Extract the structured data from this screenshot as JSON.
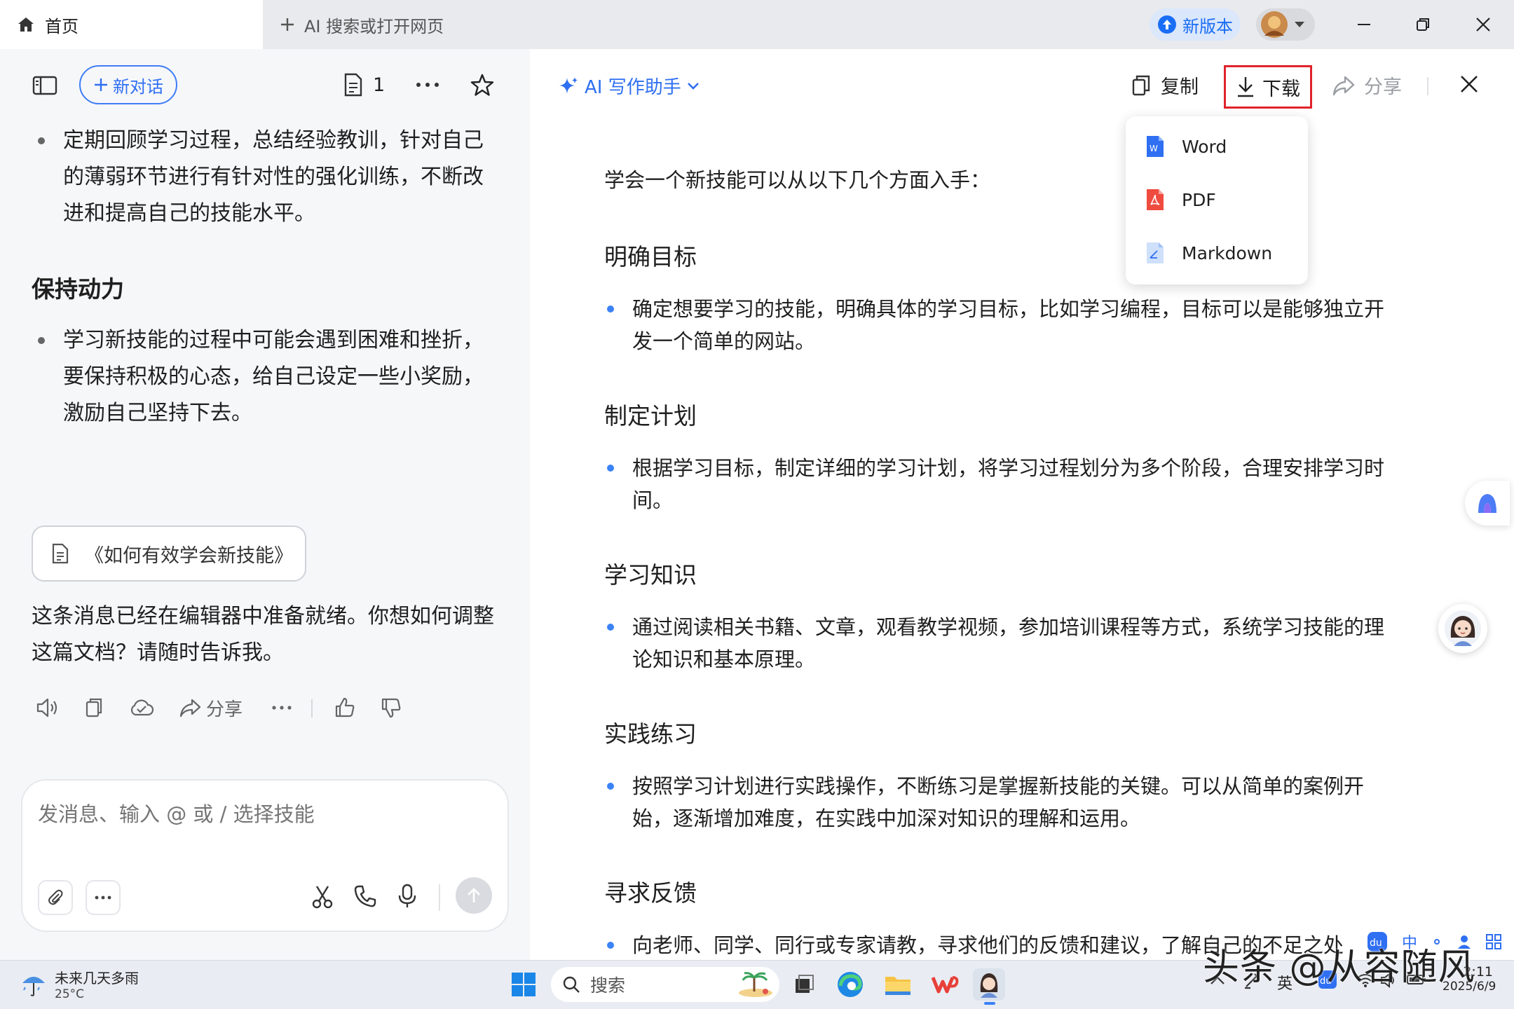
{
  "titlebar": {
    "home_tab": "首页",
    "new_tab": "AI 搜索或打开网页",
    "update_label": "新版本"
  },
  "left": {
    "new_chat_label": "新对话",
    "doc_count": "1",
    "para1": [
      "定期回顾学习过程，总结经验教训，针对自己",
      "的薄弱环节进行有针对性的强化训练，不断改",
      "进和提高自己的技能水平。"
    ],
    "heading": "保持动力",
    "para2": [
      "学习新技能的过程中可能会遇到困难和挫折，",
      "要保持积极的心态，给自己设定一些小奖励，",
      "激励自己坚持下去。"
    ],
    "doc_chip": "《如何有效学会新技能》",
    "message": [
      "这条消息已经在编辑器中准备就绪。你想如何调整",
      "这篇文档？请随时告诉我。"
    ],
    "share_label": "分享",
    "composer_placeholder": "发消息、输入 @ 或 / 选择技能"
  },
  "right": {
    "assistant_label": "AI 写作助手",
    "copy_label": "复制",
    "download_label": "下载",
    "share_label": "分享",
    "download_menu": [
      "Word",
      "PDF",
      "Markdown"
    ],
    "intro": "学会一个新技能可以从以下几个方面入手：",
    "sections": [
      {
        "title": "明确目标",
        "lines": [
          "确定想要学习的技能，明确具体的学习目标，比如学习编程，目标可以是能够独立开",
          "发一个简单的网站。"
        ]
      },
      {
        "title": "制定计划",
        "lines": [
          "根据学习目标，制定详细的学习计划，将学习过程划分为多个阶段，合理安排学习时",
          "间。"
        ]
      },
      {
        "title": "学习知识",
        "lines": [
          "通过阅读相关书籍、文章，观看教学视频，参加培训课程等方式，系统学习技能的理",
          "论知识和基本原理。"
        ]
      },
      {
        "title": "实践练习",
        "lines": [
          "按照学习计划进行实践操作，不断练习是掌握新技能的关键。可以从简单的案例开",
          "始，逐渐增加难度，在实践中加深对知识的理解和运用。"
        ]
      },
      {
        "title": "寻求反馈",
        "lines": [
          "向老师、同学、同行或专家请教，寻求他们的反馈和建议，了解自己的不足之处"
        ]
      }
    ]
  },
  "taskbar": {
    "weather_text": "未来几天多雨",
    "weather_temp": "25°C",
    "search_label": "搜索",
    "ime_cn": "中",
    "ime_lang": "英",
    "time": "2:11",
    "date": "2025/6/9"
  },
  "watermark": "头条 @从容随风",
  "colors": {
    "accent": "#2f6ff2",
    "highlight_box": "#e0232b",
    "bullet": "#3b82f6"
  }
}
